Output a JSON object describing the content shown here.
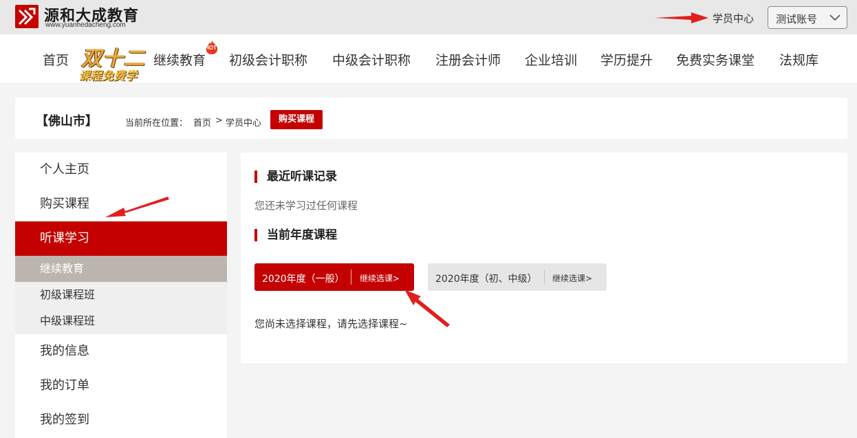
{
  "brand": {
    "name": "源和大成教育",
    "url": "www.yuanhedacheng.com"
  },
  "topbar": {
    "student_center": "学员中心",
    "account_label": "测试账号"
  },
  "nav": {
    "items": [
      "首页",
      "继续教育",
      "初级会计职称",
      "中级会计职称",
      "注册会计师",
      "企业培训",
      "学历提升",
      "免费实务课堂",
      "法规库"
    ],
    "promo_line1": "双十二",
    "promo_line2": "课程免费学",
    "hot_badge": "HOT"
  },
  "location": {
    "city": "【佛山市】",
    "crumb_prefix": "当前所在位置：",
    "crumb_home": "首页",
    "crumb_sep": ">",
    "crumb_current": "学员中心",
    "buy_button": "购买课程"
  },
  "sidebar": {
    "items": [
      "个人主页",
      "购买课程",
      "听课学习"
    ],
    "sub_items": [
      "继续教育",
      "初级课程班",
      "中级课程班"
    ],
    "bottom_items": [
      "我的信息",
      "我的订单",
      "我的签到"
    ]
  },
  "main": {
    "recent_title": "最近听课记录",
    "recent_empty": "您还未学习过任何课程",
    "year_title": "当前年度课程",
    "year_tabs": [
      {
        "label": "2020年度（一般）",
        "action": "继续选课>"
      },
      {
        "label": "2020年度（初、中级）",
        "action": "继续选课>"
      }
    ],
    "choose_hint": "您尚未选择课程，请先选择课程~"
  },
  "colors": {
    "brand_red": "#c40000",
    "topbar_bg": "#e8e8e8",
    "active_sub_bg": "#bcb5ad"
  }
}
